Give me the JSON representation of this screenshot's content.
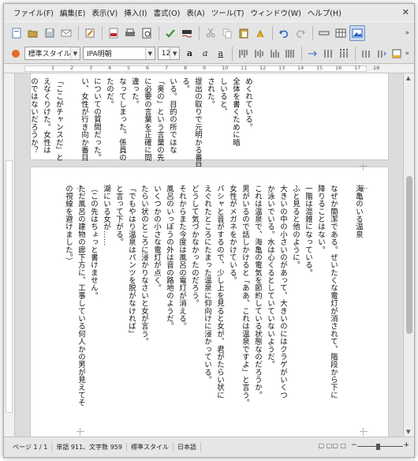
{
  "menu": {
    "items": [
      "ファイル(F)",
      "編集(E)",
      "表示(V)",
      "挿入(I)",
      "書式(O)",
      "表(A)",
      "ツール(T)",
      "ウィンドウ(W)",
      "ヘルプ(H)"
    ],
    "close_glyph": "✕"
  },
  "toolbar": {
    "style_value": "標準スタイル",
    "font_value": "IPA明朝",
    "size_value": "12"
  },
  "ruler": {
    "numbers": [
      "1",
      "2",
      "3",
      "4",
      "5",
      "6",
      "7",
      "8",
      "9",
      "10",
      "11",
      "12",
      "13",
      "14",
      "15",
      "16",
      "17",
      "18"
    ]
  },
  "document": {
    "top_columns": [
      "めくれている。",
      "全体を書くために暗",
      "しいると、",
      "された。",
      "提出の取りで元明かる番目",
      "る。",
      "いる。目的の所ではな",
      "「奥の」という言葉の先",
      "に必要の言葉を正確に間",
      "違った。",
      "なってしまった。係員の",
      "たのだ。",
      "についての質問だった。",
      "い、女性が行き向か番目",
      "",
      "「ここがチャンスだ」と",
      "えなくりけた。女性は",
      "のではないだろうか？"
    ],
    "bottom_columns": [
      "海亀のいる温泉",
      "",
      "なぜか簡潔である。ぜいたくな電灯が消されて、階段から下に",
      "降りることはない。",
      "一階は混雑になっている。",
      "ふと見ると他のように。",
      "大きいの中の小さいのがあって、大きいのにはクラゲがいくつ",
      "か泳いでいる。水は心くるとしていていないようだ。",
      "これは温泉で、海亀の電気を節約している状態なのだろうか。",
      "男がいるので話しかけると「ああ、これは温泉ですよ」と言う。",
      "女性がメガネをかけている。",
      "バシャと音がするので、少し上を見ると女が、君がたらい状に",
      "えぐれたところにたまった温泉に仰向けに浸かっている。",
      "どうして気づかなかったのだろう。",
      "それからまた今度は風呂の電灯が消える。",
      "風呂のいっぽうの外は音の路地のようだ。",
      "いくつかの小さな電灯が点く。",
      "たらい状のところに浸かりなさいと女が言う。",
      "「でもやはり温泉はパンツを脱がなければ」",
      "と言って下がる。",
      "湖にいる女が……",
      "（この先はちょっと書けません。",
      "ただ風呂の建物の廊下方に、工事している何人かの男が見えてそ",
      "の視線を避けました。）"
    ]
  },
  "status": {
    "page": "ページ 1 / 1",
    "words": "単語 911、文字数 959",
    "style": "標準スタイル",
    "language": "日本語",
    "view_icons": "▢ ▢▢ ▢",
    "zoom_minus": "−",
    "zoom_plus": "+"
  }
}
